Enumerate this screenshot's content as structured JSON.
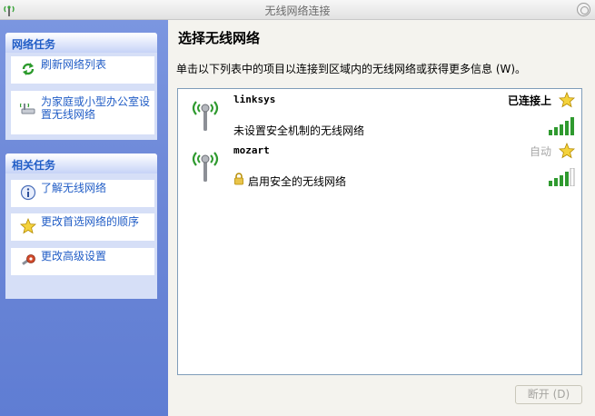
{
  "window": {
    "title": "无线网络连接"
  },
  "sidebar": {
    "network_tasks": {
      "header": "网络任务",
      "items": [
        {
          "label": "刷新网络列表",
          "icon": "refresh-icon"
        },
        {
          "label": "为家庭或小型办公室设置无线网络",
          "icon": "setup-wireless-icon"
        }
      ]
    },
    "related_tasks": {
      "header": "相关任务",
      "items": [
        {
          "label": "了解无线网络",
          "icon": "info-icon"
        },
        {
          "label": "更改首选网络的顺序",
          "icon": "star-icon"
        },
        {
          "label": "更改高级设置",
          "icon": "advanced-settings-icon"
        }
      ]
    }
  },
  "main": {
    "title": "选择无线网络",
    "description": "单击以下列表中的项目以连接到区域内的无线网络或获得更多信息 (W)。",
    "networks": [
      {
        "name": "linksys",
        "status": "已连接上",
        "security": "未设置安全机制的无线网络",
        "secured": false,
        "preferred": true,
        "signal_bars": 5
      },
      {
        "name": "mozart",
        "status": "自动",
        "security": "启用安全的无线网络",
        "secured": true,
        "preferred": true,
        "signal_bars": 4
      }
    ],
    "disconnect_button": "断开 (D)"
  },
  "colors": {
    "sidebar_link": "#215dc6",
    "sidebar_bg": "#6c87d7",
    "signal_green": "#2f9a2f",
    "star_yellow": "#f4d23c"
  }
}
